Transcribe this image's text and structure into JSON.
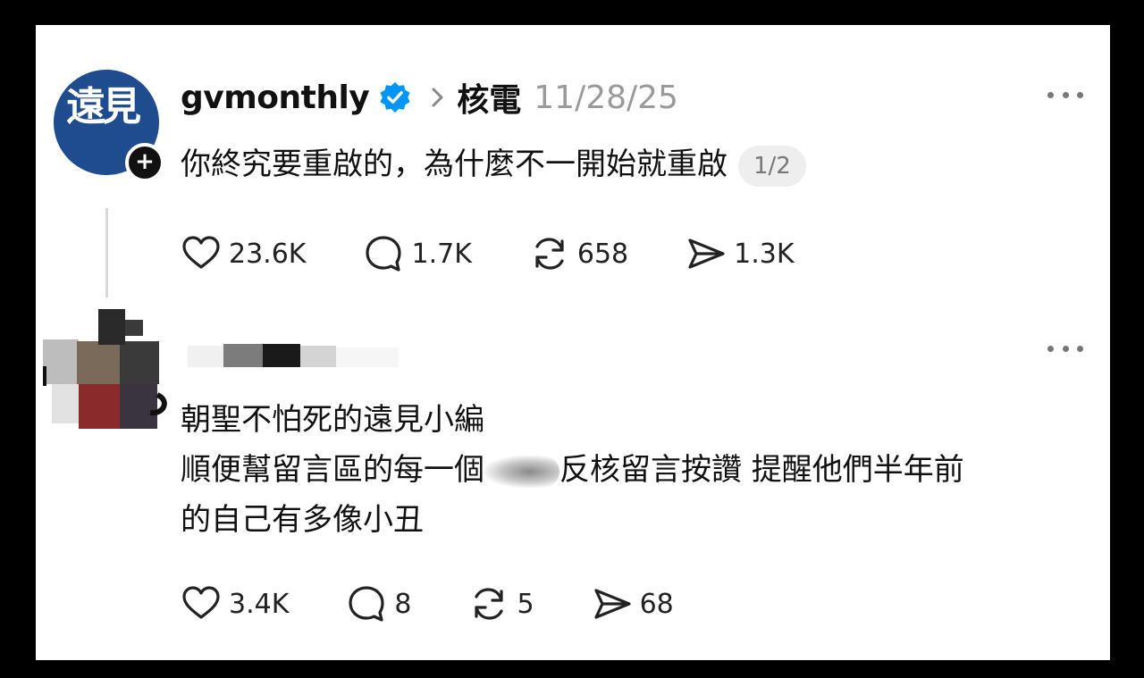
{
  "post": {
    "username": "gvmonthly",
    "avatar_text": "遠見",
    "topic": "核電",
    "date": "11/28/25",
    "text": "你終究要重啟的，為什麼不一開始就重啟",
    "page_badge": "1/2",
    "likes": "23.6K",
    "comments": "1.7K",
    "reposts": "658",
    "shares": "1.3K"
  },
  "reply": {
    "line1": "朝聖不怕死的遠見小編",
    "line2_before": "順便幫留言區的每一個",
    "line2_after": "反核留言按讚 提醒他們半年前",
    "line3": "的自己有多像小丑",
    "likes": "3.4K",
    "comments": "8",
    "reposts": "5",
    "shares": "68"
  },
  "icons": {
    "verified": "verified-badge-icon",
    "follow": "plus-icon",
    "more": "more-dots-icon",
    "like": "heart-icon",
    "comment": "comment-icon",
    "repost": "repost-icon",
    "share": "share-icon"
  },
  "colors": {
    "avatar_bg": "#1e4c8f",
    "verified": "#0095f6",
    "muted": "#9a9a9a"
  }
}
